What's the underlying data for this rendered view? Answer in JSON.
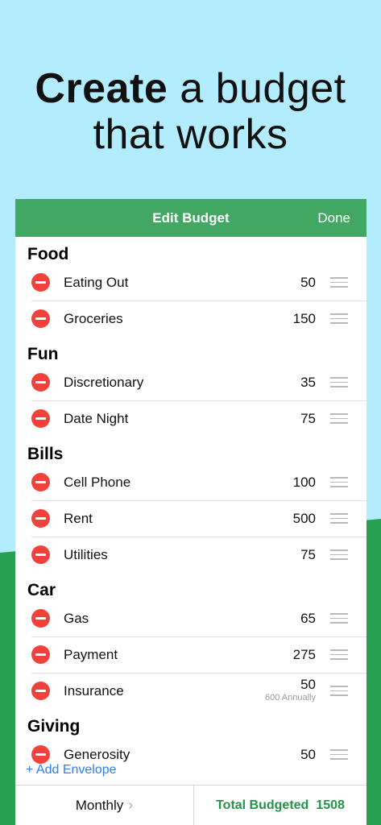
{
  "headline": {
    "bold": "Create",
    "rest_line1": " a budget",
    "line2": "that works"
  },
  "navbar": {
    "title": "Edit Budget",
    "done": "Done"
  },
  "groups": [
    {
      "name": "Food",
      "items": [
        {
          "label": "Eating Out",
          "amount": "50"
        },
        {
          "label": "Groceries",
          "amount": "150"
        }
      ]
    },
    {
      "name": "Fun",
      "items": [
        {
          "label": "Discretionary",
          "amount": "35"
        },
        {
          "label": "Date Night",
          "amount": "75"
        }
      ]
    },
    {
      "name": "Bills",
      "items": [
        {
          "label": "Cell Phone",
          "amount": "100"
        },
        {
          "label": "Rent",
          "amount": "500"
        },
        {
          "label": "Utilities",
          "amount": "75"
        }
      ]
    },
    {
      "name": "Car",
      "items": [
        {
          "label": "Gas",
          "amount": "65"
        },
        {
          "label": "Payment",
          "amount": "275"
        },
        {
          "label": "Insurance",
          "amount": "50",
          "sub": "600 Annually"
        }
      ]
    },
    {
      "name": "Giving",
      "items": [
        {
          "label": "Generosity",
          "amount": "50"
        }
      ]
    }
  ],
  "add_envelope": "+ Add Envelope",
  "footer": {
    "period": "Monthly",
    "chevron": "›",
    "total_label": "Total Budgeted",
    "total_value": "1508"
  },
  "colors": {
    "sky": "#b3ecfd",
    "hill": "#27a050",
    "navbar": "#43a764",
    "delete": "#f2403a",
    "link": "#2f7cf6",
    "total": "#24934a"
  }
}
